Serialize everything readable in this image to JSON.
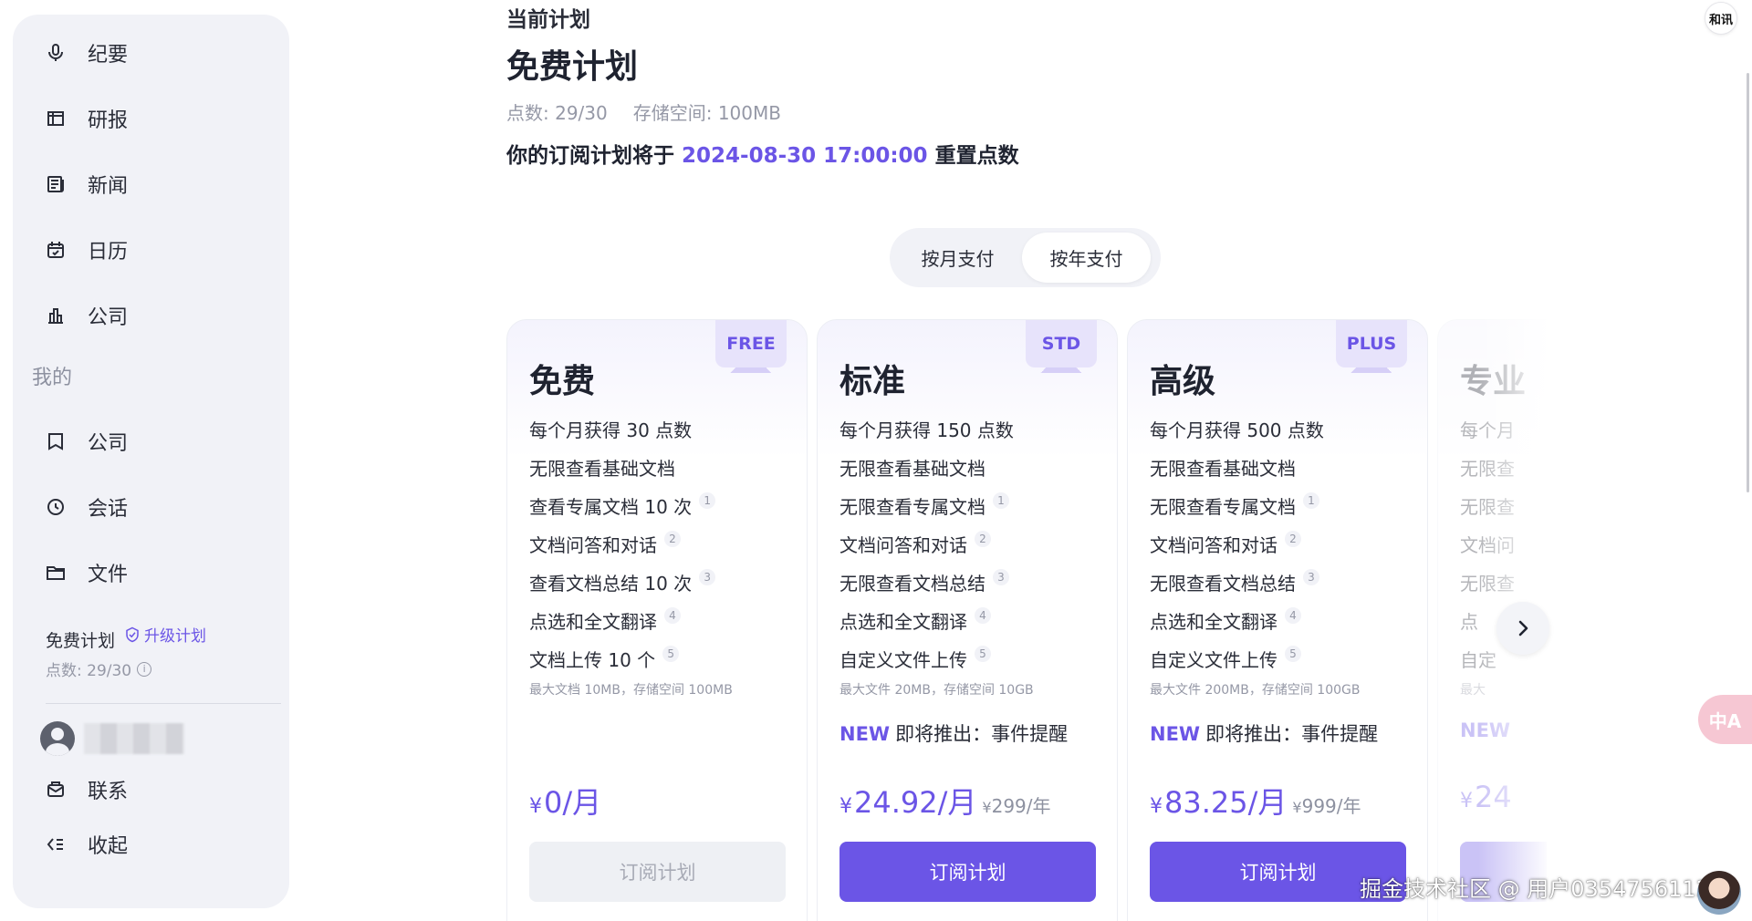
{
  "sidebar": {
    "top_items": [
      {
        "label": "纪要",
        "icon": "mic-icon"
      },
      {
        "label": "研报",
        "icon": "report-icon"
      },
      {
        "label": "新闻",
        "icon": "news-icon"
      },
      {
        "label": "日历",
        "icon": "calendar-icon"
      },
      {
        "label": "公司",
        "icon": "company-chart-icon"
      }
    ],
    "section_title": "我的",
    "my_items": [
      {
        "label": "公司",
        "icon": "bookmark-icon"
      },
      {
        "label": "会话",
        "icon": "clock-icon"
      },
      {
        "label": "文件",
        "icon": "folder-icon"
      }
    ],
    "plan_name": "免费计划",
    "upgrade_label": "升级计划",
    "points": "点数: 29/30",
    "bottom_items": [
      {
        "label": "联系",
        "icon": "mail-icon"
      },
      {
        "label": "收起",
        "icon": "collapse-icon"
      }
    ]
  },
  "main": {
    "current_label": "当前计划",
    "plan_title": "免费计划",
    "points": "点数: 29/30",
    "storage": "存储空间: 100MB",
    "reset_prefix": "你的订阅计划将于",
    "reset_date": "2024-08-30 17:00:00",
    "reset_suffix": "重置点数"
  },
  "billing_toggle": {
    "monthly": "按月支付",
    "yearly": "按年支付",
    "selected": "yearly"
  },
  "plans": [
    {
      "badge": "FREE",
      "name": "免费",
      "features": [
        {
          "text": "每个月获得 30 点数",
          "note": ""
        },
        {
          "text": "无限查看基础文档",
          "note": ""
        },
        {
          "text": "查看专属文档 10 次",
          "note": "1"
        },
        {
          "text": "文档问答和对话",
          "note": "2"
        },
        {
          "text": "查看文档总结 10 次",
          "note": "3"
        },
        {
          "text": "点选和全文翻译",
          "note": "4"
        },
        {
          "text": "文档上传 10 个",
          "note": "5"
        }
      ],
      "fine_print": "最大文档 10MB，存储空间 100MB",
      "new_tag": "",
      "new_text": "",
      "price_currency": "¥",
      "price": "0/月",
      "yearly_currency": "",
      "yearly": "",
      "button": "订阅计划",
      "button_enabled": false
    },
    {
      "badge": "STD",
      "name": "标准",
      "features": [
        {
          "text": "每个月获得 150 点数",
          "note": ""
        },
        {
          "text": "无限查看基础文档",
          "note": ""
        },
        {
          "text": "无限查看专属文档",
          "note": "1"
        },
        {
          "text": "文档问答和对话",
          "note": "2"
        },
        {
          "text": "无限查看文档总结",
          "note": "3"
        },
        {
          "text": "点选和全文翻译",
          "note": "4"
        },
        {
          "text": "自定义文件上传",
          "note": "5"
        }
      ],
      "fine_print": "最大文件 20MB，存储空间 10GB",
      "new_tag": "NEW",
      "new_text": "即将推出：事件提醒",
      "price_currency": "¥",
      "price": "24.92/月",
      "yearly_currency": "¥",
      "yearly": "299/年",
      "button": "订阅计划",
      "button_enabled": true
    },
    {
      "badge": "PLUS",
      "name": "高级",
      "features": [
        {
          "text": "每个月获得 500 点数",
          "note": ""
        },
        {
          "text": "无限查看基础文档",
          "note": ""
        },
        {
          "text": "无限查看专属文档",
          "note": "1"
        },
        {
          "text": "文档问答和对话",
          "note": "2"
        },
        {
          "text": "无限查看文档总结",
          "note": "3"
        },
        {
          "text": "点选和全文翻译",
          "note": "4"
        },
        {
          "text": "自定义文件上传",
          "note": "5"
        }
      ],
      "fine_print": "最大文件 200MB，存储空间 100GB",
      "new_tag": "NEW",
      "new_text": "即将推出：事件提醒",
      "price_currency": "¥",
      "price": "83.25/月",
      "yearly_currency": "¥",
      "yearly": "999/年",
      "button": "订阅计划",
      "button_enabled": true
    },
    {
      "badge": "",
      "name": "专业",
      "features": [
        {
          "text": "每个月",
          "note": ""
        },
        {
          "text": "无限查",
          "note": ""
        },
        {
          "text": "无限查",
          "note": ""
        },
        {
          "text": "文档问",
          "note": ""
        },
        {
          "text": "无限查",
          "note": ""
        },
        {
          "text": "点",
          "note": ""
        },
        {
          "text": "自定",
          "note": ""
        }
      ],
      "fine_print": "最大",
      "new_tag": "NEW",
      "new_text": "",
      "price_currency": "¥",
      "price": "24",
      "yearly_currency": "",
      "yearly": "",
      "button": "",
      "button_enabled": true
    }
  ],
  "brand_logo_text": "和讯",
  "translate_fab_text": "中A",
  "watermark": "掘金技术社区 @ 用户035475611288",
  "colors": {
    "accent": "#6b55e6",
    "sidebar_bg": "#f1f2f7",
    "badge_bg": "#e7e3fb"
  }
}
